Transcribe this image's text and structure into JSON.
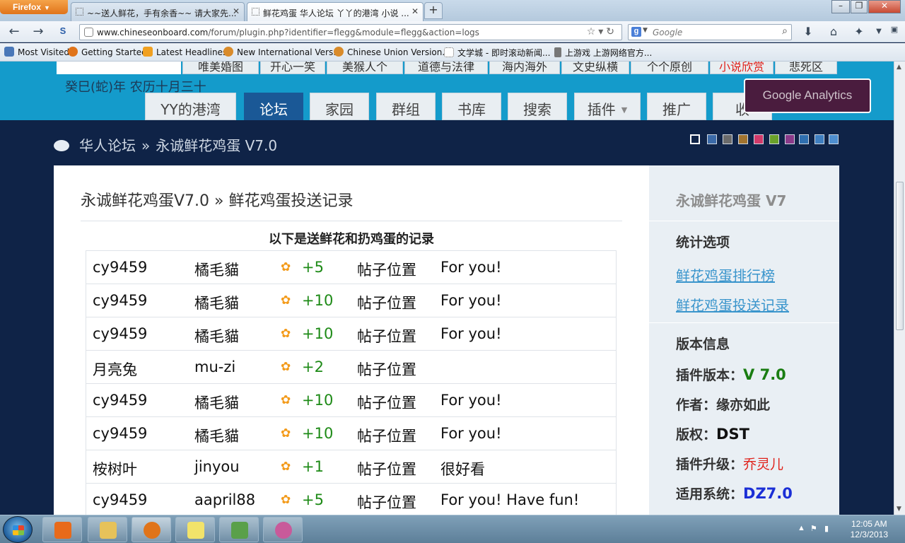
{
  "browser": {
    "firefox_label": "Firefox",
    "tabs": [
      {
        "title": "~~送人鲜花，手有余香~~ 请大家先..."
      },
      {
        "title": "鲜花鸡蛋 华人论坛 丫丫的港湾 小说 ..."
      }
    ],
    "url_domain": "www.chineseonboard.com",
    "url_path": "/forum/plugin.php?identifier=flegg&module=flegg&action=logs",
    "search_placeholder": "Google",
    "search_engine_icon": "google-icon",
    "bookmarks": [
      {
        "label": "Most Visited",
        "icon": "most-visited-icon",
        "color": "#4a78b8"
      },
      {
        "label": "Getting Started",
        "icon": "firefox-icon",
        "color": "#e0741a"
      },
      {
        "label": "Latest Headlines",
        "icon": "rss-icon",
        "color": "#f0a020"
      },
      {
        "label": "New International Vers...",
        "icon": "bible-icon",
        "color": "#d98b2a"
      },
      {
        "label": "Chinese Union Version...",
        "icon": "bible-icon",
        "color": "#d98b2a"
      },
      {
        "label": "文学城 - 即时滚动新闻...",
        "icon": "page-icon",
        "color": "#ffffff"
      },
      {
        "label": "上游戏 上游网络官方...",
        "icon": "slingshot-icon",
        "color": "#777777"
      }
    ]
  },
  "site": {
    "top_links": [
      "唯美婚图",
      "开心一笑",
      "美猴人个",
      "道德与法律",
      "海内海外",
      "文史纵横",
      "个个原创",
      "小说欣赏",
      "悲死区"
    ],
    "lunar_date": "癸巳(蛇)年 农历十月三十",
    "main_nav": [
      {
        "label": "YY的港湾"
      },
      {
        "label": "论坛"
      },
      {
        "label": "家园"
      },
      {
        "label": "群组"
      },
      {
        "label": "书库"
      },
      {
        "label": "搜索"
      },
      {
        "label": "插件"
      },
      {
        "label": "推广"
      },
      {
        "label": "收"
      }
    ],
    "ga_button": "Google Analytics",
    "breadcrumb": {
      "home": "华人论坛",
      "sep": "»",
      "current": "永诚鲜花鸡蛋 V7.0"
    },
    "theme_colors": [
      "#0f2347",
      "#3b6aa8",
      "#6b6b6b",
      "#a2742f",
      "#d23a6a",
      "#6aa12a",
      "#8a3a8a",
      "#2f6fb0",
      "#3f7fc0",
      "#4f8fd0"
    ],
    "accent_colors": {
      "header": "#149bcb",
      "page_bg": "#0f2347",
      "active_nav": "#1a5896"
    }
  },
  "main": {
    "title_part1": "永诚鲜花鸡蛋V7.0",
    "title_sep": "»",
    "title_part2": "鲜花鸡蛋投送记录",
    "caption": "以下是送鲜花和扔鸡蛋的记录",
    "records": [
      {
        "from": "cy9459",
        "to": "橘毛貓",
        "flower_icon": "flower-icon",
        "score": "+5",
        "post": "帖子位置",
        "message": "For you!"
      },
      {
        "from": "cy9459",
        "to": "橘毛貓",
        "flower_icon": "flower-icon",
        "score": "+10",
        "post": "帖子位置",
        "message": "For you!"
      },
      {
        "from": "cy9459",
        "to": "橘毛貓",
        "flower_icon": "flower-icon",
        "score": "+10",
        "post": "帖子位置",
        "message": "For you!"
      },
      {
        "from": "月亮兔",
        "to": "mu-zi",
        "flower_icon": "flower-icon",
        "score": "+2",
        "post": "帖子位置",
        "message": ""
      },
      {
        "from": "cy9459",
        "to": "橘毛貓",
        "flower_icon": "flower-icon",
        "score": "+10",
        "post": "帖子位置",
        "message": "For you!"
      },
      {
        "from": "cy9459",
        "to": "橘毛貓",
        "flower_icon": "flower-icon",
        "score": "+10",
        "post": "帖子位置",
        "message": "For you!"
      },
      {
        "from": "桉树叶",
        "to": "jinyou",
        "flower_icon": "flower-icon",
        "score": "+1",
        "post": "帖子位置",
        "message": "很好看"
      },
      {
        "from": "cy9459",
        "to": "aapril88",
        "flower_icon": "flower-icon",
        "score": "+5",
        "post": "帖子位置",
        "message": "For you! Have fun!"
      }
    ]
  },
  "sidebar": {
    "title": "永诚鲜花鸡蛋 V7",
    "stats_heading": "统计选项",
    "links": [
      "鲜花鸡蛋排行榜",
      "鲜花鸡蛋投送记录"
    ],
    "version_heading": "版本信息",
    "version_label": "插件版本：",
    "version_value": "V 7.0",
    "author_label": "作者：",
    "author_value": "缘亦如此",
    "copyright_label": "版权：",
    "copyright_value": "DST",
    "upgrade_label": "插件升级：",
    "upgrade_value": "乔灵儿",
    "system_label": "适用系统：",
    "system_value": "DZ7.0"
  },
  "taskbar": {
    "apps": [
      {
        "name": "media-player-icon",
        "color": "#e86a1a"
      },
      {
        "name": "file-explorer-icon",
        "color": "#e6c25a"
      },
      {
        "name": "firefox-icon",
        "color": "#e0741a"
      },
      {
        "name": "sticky-notes-icon",
        "color": "#f2e36a"
      },
      {
        "name": "remote-desktop-icon",
        "color": "#5aa04a"
      },
      {
        "name": "paint-icon",
        "color": "#c85a9a"
      }
    ],
    "time": "12:05 AM",
    "date": "12/3/2013"
  }
}
